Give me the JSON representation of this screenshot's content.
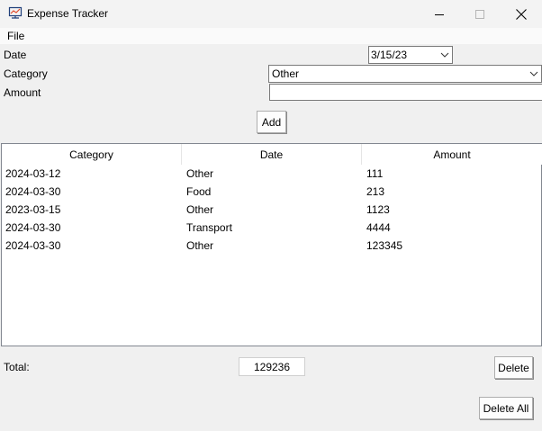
{
  "window": {
    "title": "Expense Tracker",
    "icon": "expense-tracker-app-icon",
    "controls": {
      "minimize": "minimize-icon",
      "maximize": "maximize-icon",
      "close": "close-icon"
    }
  },
  "menu": {
    "file": "File"
  },
  "form": {
    "date_label": "Date",
    "date_value": "3/15/23",
    "category_label": "Category",
    "category_value": "Other",
    "amount_label": "Amount",
    "amount_value": "",
    "add_button": "Add"
  },
  "table": {
    "columns": [
      "Category",
      "Date",
      "Amount"
    ],
    "rows": [
      [
        "2024-03-12",
        "Other",
        "111"
      ],
      [
        "2024-03-30",
        "Food",
        "213"
      ],
      [
        "2023-03-15",
        "Other",
        "1123"
      ],
      [
        "2024-03-30",
        "Transport",
        "4444"
      ],
      [
        "2024-03-30",
        "Other",
        "123345"
      ]
    ]
  },
  "footer": {
    "total_label": "Total:",
    "total_value": "129236",
    "delete_button": "Delete",
    "delete_all_button": "Delete All"
  }
}
